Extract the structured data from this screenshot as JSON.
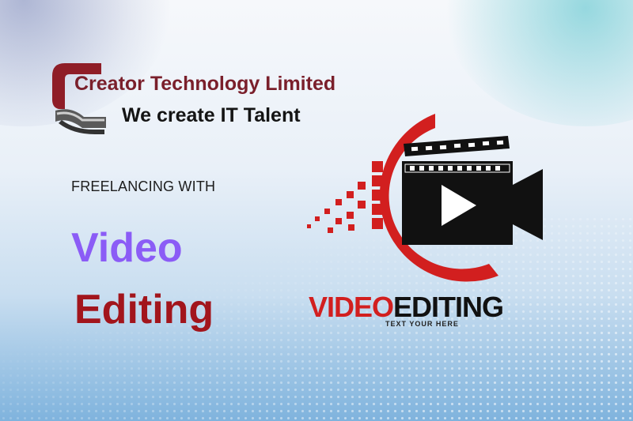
{
  "company": {
    "name": "Creator Technology Limited",
    "tagline": "We create IT Talent"
  },
  "course": {
    "intro": "FREELANCING WITH",
    "word1": "Video",
    "word2": "Editing"
  },
  "video_logo": {
    "title_red": "VIDEO",
    "title_black": "EDITING",
    "subtitle": "TEXT YOUR HERE",
    "icon": "video-camera-icon"
  },
  "colors": {
    "brand_maroon": "#7a1f2b",
    "accent_purple": "#8b5cf6",
    "accent_red": "#a2151c",
    "logo_red": "#d21f1f",
    "logo_black": "#111111",
    "background_blue": "#7fb3dd"
  }
}
